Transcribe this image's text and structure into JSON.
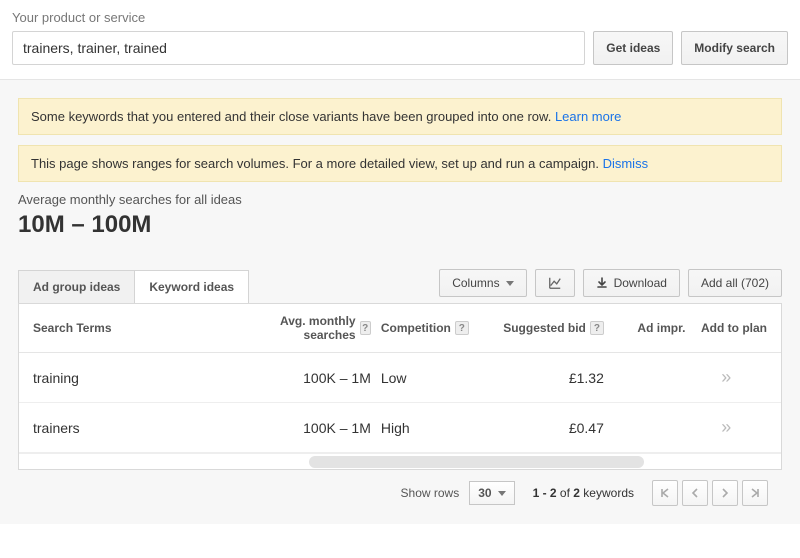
{
  "top": {
    "label": "Your product or service",
    "input_value": "trainers, trainer, trained",
    "get_ideas": "Get ideas",
    "modify_search": "Modify search"
  },
  "notices": {
    "grouped": {
      "text": "Some keywords that you entered and their close variants have been grouped into one row. ",
      "link": "Learn more"
    },
    "ranges": {
      "text": "This page shows ranges for search volumes. For a more detailed view, set up and run a campaign. ",
      "link": "Dismiss"
    }
  },
  "summary": {
    "label": "Average monthly searches for all ideas",
    "value": "10M – 100M"
  },
  "tabs": {
    "adgroup": "Ad group ideas",
    "keyword": "Keyword ideas"
  },
  "toolbar": {
    "columns": "Columns",
    "download": "Download",
    "add_all": "Add all (702)"
  },
  "table": {
    "headers": {
      "terms": "Search Terms",
      "avg": "Avg. monthly searches",
      "competition": "Competition",
      "bid": "Suggested bid",
      "impr": "Ad impr.",
      "add": "Add to plan"
    },
    "rows": [
      {
        "term": "training",
        "avg": "100K – 1M",
        "competition": "Low",
        "bid": "£1.32"
      },
      {
        "term": "trainers",
        "avg": "100K – 1M",
        "competition": "High",
        "bid": "£0.47"
      }
    ]
  },
  "footer": {
    "show_rows": "Show rows",
    "rows_value": "30",
    "pagination_prefix": "1 - 2",
    "pagination_of": " of ",
    "pagination_total": "2",
    "pagination_suffix": " keywords"
  },
  "chart_data": {
    "type": "table",
    "title": "Keyword ideas",
    "columns": [
      "Search Terms",
      "Avg. monthly searches",
      "Competition",
      "Suggested bid"
    ],
    "rows": [
      [
        "training",
        "100K – 1M",
        "Low",
        "£1.32"
      ],
      [
        "trainers",
        "100K – 1M",
        "High",
        "£0.47"
      ]
    ],
    "summary": "Average monthly searches for all ideas: 10M – 100M",
    "total_results": 702
  }
}
